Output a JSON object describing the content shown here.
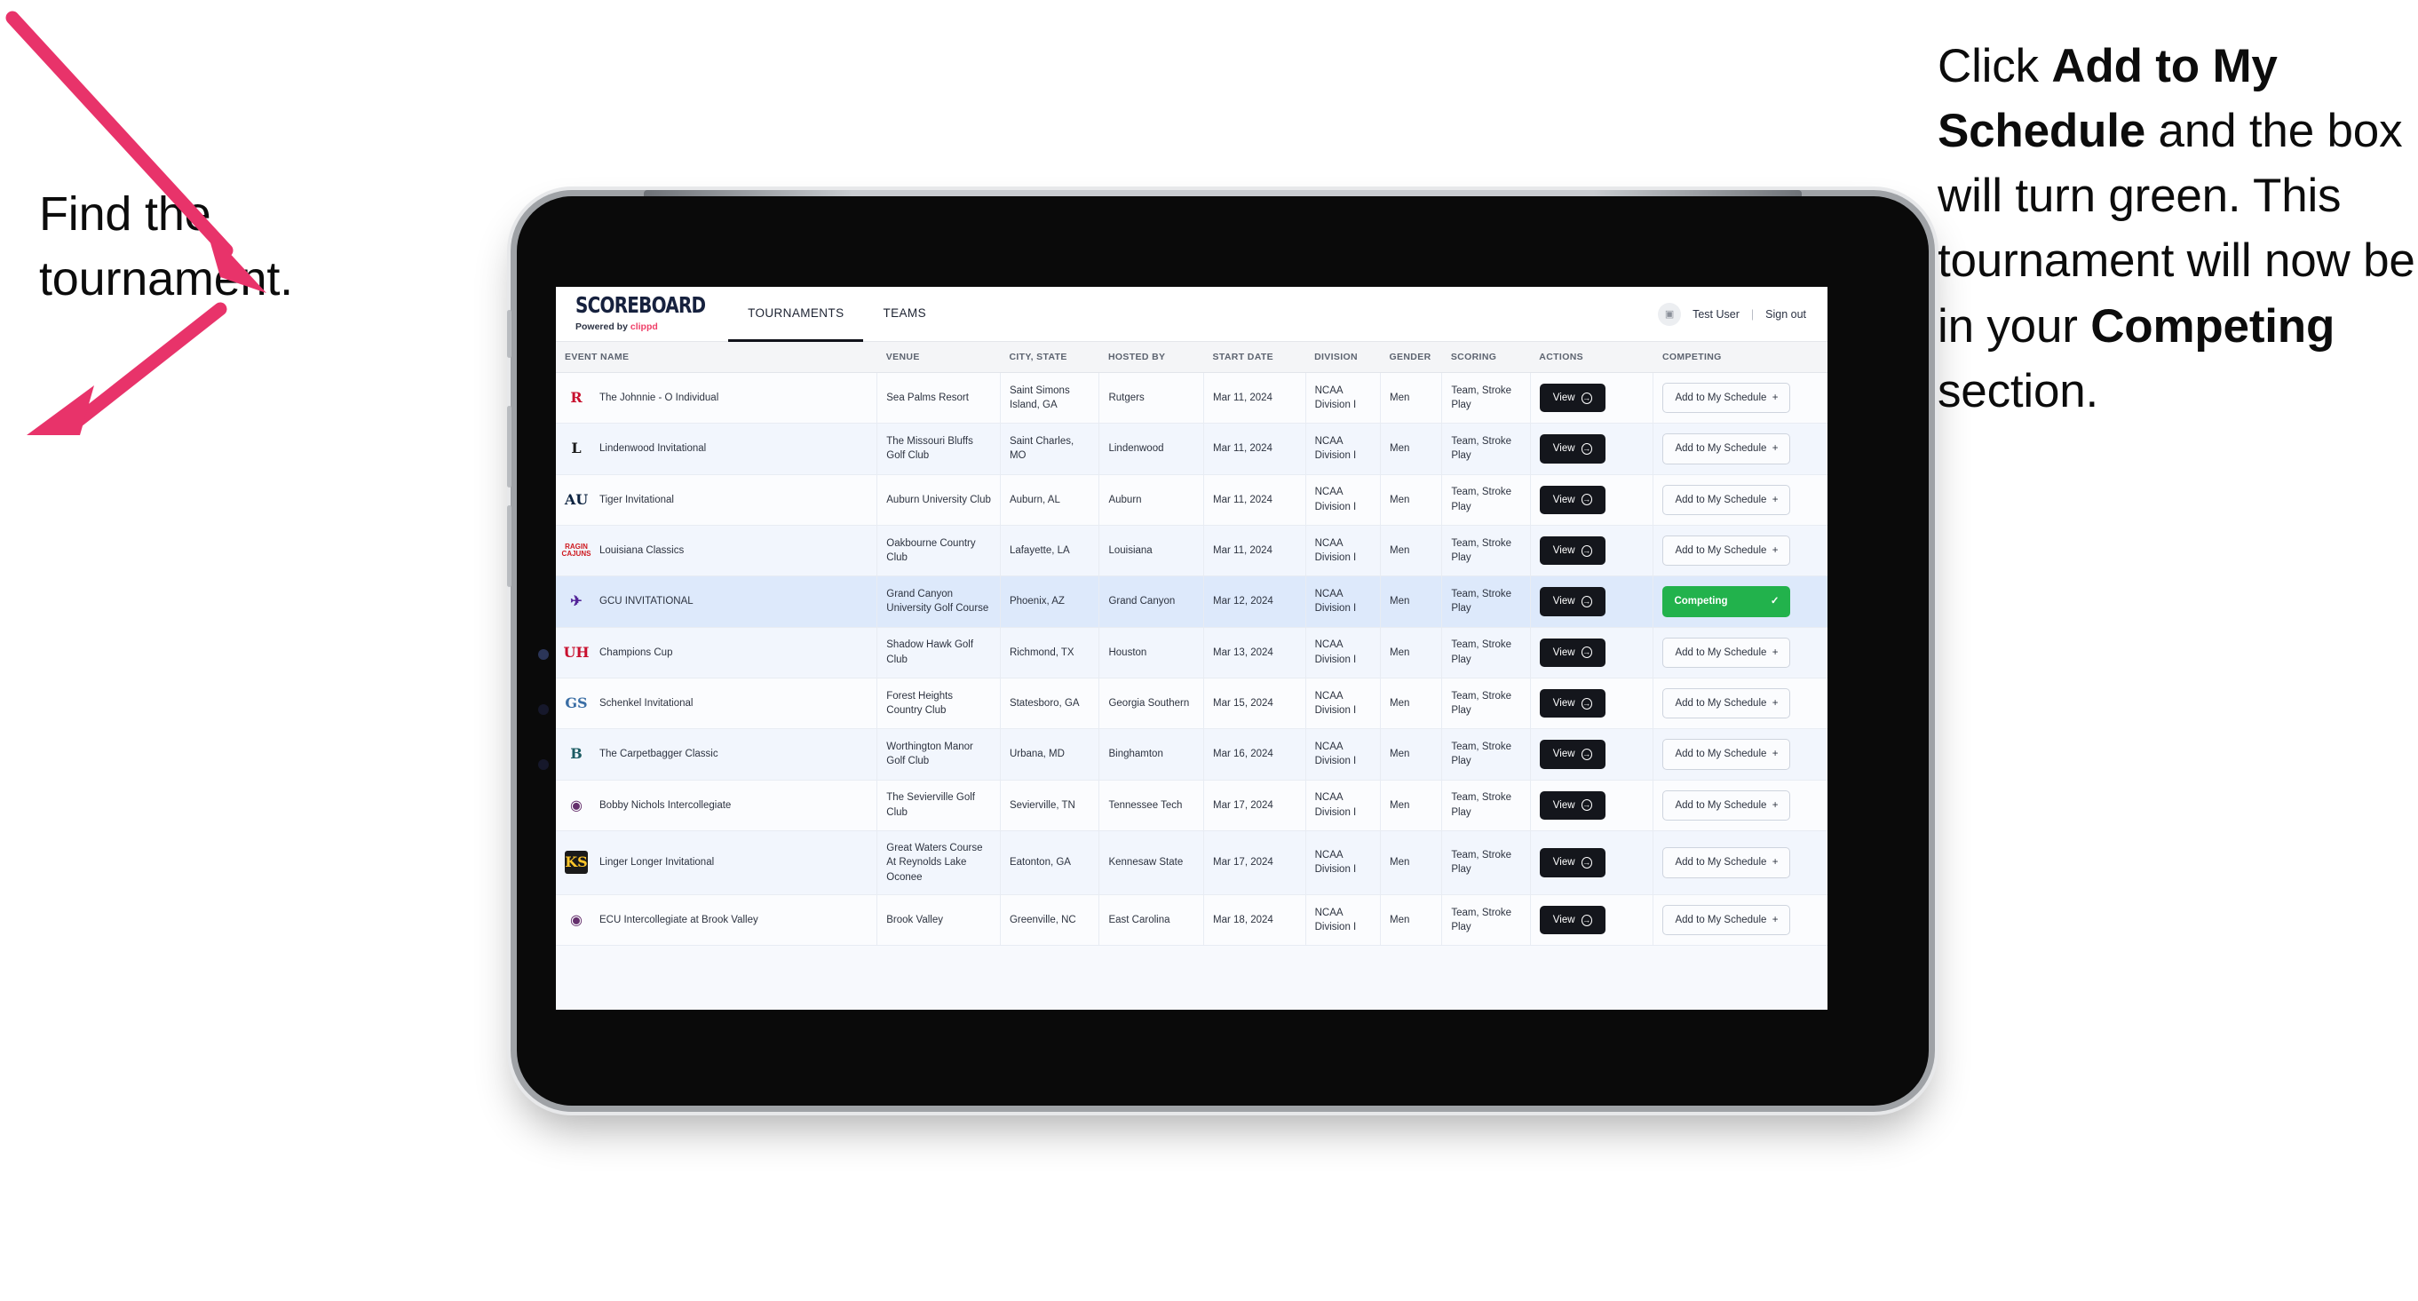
{
  "annotations": {
    "left": "Find the tournament.",
    "right_parts": [
      {
        "t": "Click ",
        "b": false
      },
      {
        "t": "Add to My Schedule",
        "b": true
      },
      {
        "t": " and the box will turn green. This tournament will now be in your ",
        "b": false
      },
      {
        "t": "Competing",
        "b": true
      },
      {
        "t": " section.",
        "b": false
      }
    ],
    "arrow_color": "#E8336A"
  },
  "app": {
    "brand_name": "SCOREBOARD",
    "brand_sub_prefix": "Powered by ",
    "brand_sub_accent": "clippd",
    "tabs": [
      {
        "label": "TOURNAMENTS",
        "active": true
      },
      {
        "label": "TEAMS",
        "active": false
      }
    ],
    "user": {
      "avatar_glyph": "▣",
      "name": "Test User",
      "separator": "|",
      "signout": "Sign out"
    }
  },
  "table": {
    "columns": [
      "EVENT NAME",
      "VENUE",
      "CITY, STATE",
      "HOSTED BY",
      "START DATE",
      "DIVISION",
      "GENDER",
      "SCORING",
      "ACTIONS",
      "COMPETING"
    ],
    "view_label": "View",
    "add_label": "Add to My Schedule",
    "add_glyph": "+",
    "competing_label": "Competing",
    "competing_glyph": "✓",
    "competing_color": "#22B24C",
    "rows": [
      {
        "logo": {
          "text": "R",
          "color": "#C8102E",
          "bg": "transparent"
        },
        "event": "The Johnnie - O Individual",
        "venue": "Sea Palms Resort",
        "city": "Saint Simons Island, GA",
        "hosted_by": "Rutgers",
        "start_date": "Mar 11, 2024",
        "division": "NCAA Division I",
        "gender": "Men",
        "scoring": "Team, Stroke Play",
        "competing": false
      },
      {
        "logo": {
          "text": "L",
          "color": "#1a1a1a",
          "bg": "transparent"
        },
        "event": "Lindenwood Invitational",
        "venue": "The Missouri Bluffs Golf Club",
        "city": "Saint Charles, MO",
        "hosted_by": "Lindenwood",
        "start_date": "Mar 11, 2024",
        "division": "NCAA Division I",
        "gender": "Men",
        "scoring": "Team, Stroke Play",
        "competing": false
      },
      {
        "logo": {
          "text": "AU",
          "color": "#0C2340",
          "bg": "transparent"
        },
        "event": "Tiger Invitational",
        "venue": "Auburn University Club",
        "city": "Auburn, AL",
        "hosted_by": "Auburn",
        "start_date": "Mar 11, 2024",
        "division": "NCAA Division I",
        "gender": "Men",
        "scoring": "Team, Stroke Play",
        "competing": false
      },
      {
        "logo": {
          "text": "RAGIN CAJUNS",
          "color": "#CE181E",
          "bg": "transparent",
          "small": true
        },
        "event": "Louisiana Classics",
        "venue": "Oakbourne Country Club",
        "city": "Lafayette, LA",
        "hosted_by": "Louisiana",
        "start_date": "Mar 11, 2024",
        "division": "NCAA Division I",
        "gender": "Men",
        "scoring": "Team, Stroke Play",
        "competing": false
      },
      {
        "logo": {
          "text": "✈",
          "color": "#522398",
          "bg": "transparent"
        },
        "event": "GCU INVITATIONAL",
        "venue": "Grand Canyon University Golf Course",
        "city": "Phoenix, AZ",
        "hosted_by": "Grand Canyon",
        "start_date": "Mar 12, 2024",
        "division": "NCAA Division I",
        "gender": "Men",
        "scoring": "Team, Stroke Play",
        "competing": true,
        "selected": true
      },
      {
        "logo": {
          "text": "UH",
          "color": "#C8102E",
          "bg": "transparent"
        },
        "event": "Champions Cup",
        "venue": "Shadow Hawk Golf Club",
        "city": "Richmond, TX",
        "hosted_by": "Houston",
        "start_date": "Mar 13, 2024",
        "division": "NCAA Division I",
        "gender": "Men",
        "scoring": "Team, Stroke Play",
        "competing": false
      },
      {
        "logo": {
          "text": "GS",
          "color": "#3a6ea5",
          "bg": "transparent"
        },
        "event": "Schenkel Invitational",
        "venue": "Forest Heights Country Club",
        "city": "Statesboro, GA",
        "hosted_by": "Georgia Southern",
        "start_date": "Mar 15, 2024",
        "division": "NCAA Division I",
        "gender": "Men",
        "scoring": "Team, Stroke Play",
        "competing": false
      },
      {
        "logo": {
          "text": "B",
          "color": "#1d5c63",
          "bg": "transparent"
        },
        "event": "The Carpetbagger Classic",
        "venue": "Worthington Manor Golf Club",
        "city": "Urbana, MD",
        "hosted_by": "Binghamton",
        "start_date": "Mar 16, 2024",
        "division": "NCAA Division I",
        "gender": "Men",
        "scoring": "Team, Stroke Play",
        "competing": false
      },
      {
        "logo": {
          "text": "◉",
          "color": "#642f6c",
          "bg": "transparent"
        },
        "event": "Bobby Nichols Intercollegiate",
        "venue": "The Sevierville Golf Club",
        "city": "Sevierville, TN",
        "hosted_by": "Tennessee Tech",
        "start_date": "Mar 17, 2024",
        "division": "NCAA Division I",
        "gender": "Men",
        "scoring": "Team, Stroke Play",
        "competing": false
      },
      {
        "logo": {
          "text": "KS",
          "color": "#FFC629",
          "bg": "#1a1a1a"
        },
        "event": "Linger Longer Invitational",
        "venue": "Great Waters Course At Reynolds Lake Oconee",
        "city": "Eatonton, GA",
        "hosted_by": "Kennesaw State",
        "start_date": "Mar 17, 2024",
        "division": "NCAA Division I",
        "gender": "Men",
        "scoring": "Team, Stroke Play",
        "competing": false
      },
      {
        "logo": {
          "text": "◉",
          "color": "#642f6c",
          "bg": "transparent"
        },
        "event": "ECU Intercollegiate at Brook Valley",
        "venue": "Brook Valley",
        "city": "Greenville, NC",
        "hosted_by": "East Carolina",
        "start_date": "Mar 18, 2024",
        "division": "NCAA Division I",
        "gender": "Men",
        "scoring": "Team, Stroke Play",
        "competing": false
      }
    ]
  }
}
